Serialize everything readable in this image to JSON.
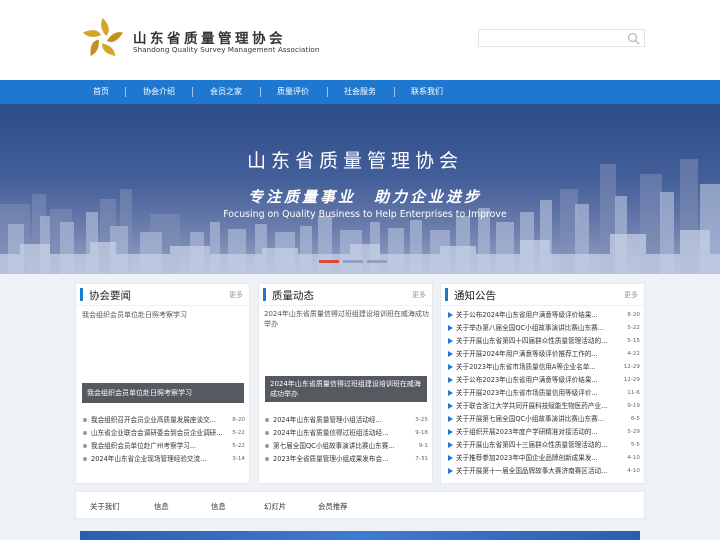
{
  "header": {
    "org_name_cn": "山东省质量管理协会",
    "org_name_en": "Shandong Quality Survey Management Association",
    "search_placeholder": ""
  },
  "nav": {
    "items": [
      "首页",
      "协会介绍",
      "会员之家",
      "质量评价",
      "社会服务",
      "联系我们"
    ]
  },
  "banner": {
    "title": "山东省质量管理协会",
    "slogan": "专注质量事业　助力企业进步",
    "slogan_en": "Focusing on Quality Business to Help Enterprises to Improve",
    "slides_total": 3,
    "active_slide": 1
  },
  "news": {
    "title": "协会要闻",
    "more": "更多",
    "photo_alt": "我会组织会员单位赴日照考察学习",
    "photo_caption": "我会组织会员单位赴日照考察学习",
    "items": [
      {
        "title": "我会组织召开会员企业高质量发展座谈交...",
        "date": "8-20"
      },
      {
        "title": "山东省企业联合会调研委会到会员企业调研...",
        "date": "5-22"
      },
      {
        "title": "我会组织会员单位赴广州考察学习...",
        "date": "5-22"
      },
      {
        "title": "2024年山东省企业现场管理经验交流...",
        "date": "3-14"
      }
    ]
  },
  "quality": {
    "title": "质量动态",
    "more": "更多",
    "photo_alt": "2024年山东省质量信得过班组建设培训班在威海成功举办",
    "photo_caption": "2024年山东省质量信得过班组建设培训班在威海成功举办",
    "items": [
      {
        "title": "2024年山东省质量管理小组活动经...",
        "date": "3-25"
      },
      {
        "title": "2024年山东省质量信得过班组活动经...",
        "date": "9-18"
      },
      {
        "title": "第七届全国QC小组故事演讲比赛山东赛...",
        "date": "9-1"
      },
      {
        "title": "2023年全省质量管理小组成果发布会...",
        "date": "7-31"
      }
    ]
  },
  "notices": {
    "title": "通知公告",
    "more": "更多",
    "items": [
      {
        "title": "关于公布2024年山东省用户满意等级评价结果...",
        "date": "8-20"
      },
      {
        "title": "关于举办第八届全国QC小组故事演讲比赛山东赛...",
        "date": "5-22"
      },
      {
        "title": "关于开展山东省第四十四届群众性质量管理活动的...",
        "date": "5-15"
      },
      {
        "title": "关于开展2024年用户满意等级评价推荐工作的...",
        "date": "4-22"
      },
      {
        "title": "关于2023年山东省市场质量信用A等企业名单...",
        "date": "12-29"
      },
      {
        "title": "关于公布2023年山东省用户满意等级评价结果...",
        "date": "12-29"
      },
      {
        "title": "关于开展2023年山东省市场质量信用等级评价...",
        "date": "11-6"
      },
      {
        "title": "关于联合浙江大学共同开展科技赋能生物医药产业...",
        "date": "9-19"
      },
      {
        "title": "关于开展第七届全国QC小组故事演讲比赛山东赛...",
        "date": "6-5"
      },
      {
        "title": "关于组织开展2023年度产学研精准对接活动的...",
        "date": "5-29"
      },
      {
        "title": "关于开展山东省第四十三届群众性质量管理活动的...",
        "date": "5-5"
      },
      {
        "title": "关于推荐参加2023年中国企业品牌创新成果发...",
        "date": "4-10"
      },
      {
        "title": "关于开展第十一届全国品牌故事大赛济南赛区活动...",
        "date": "4-10"
      }
    ]
  },
  "footer": {
    "links": [
      "关于我们",
      "信息",
      "信息",
      "幻灯片",
      "会员推荐"
    ]
  },
  "colors": {
    "accent": "#1f78d0",
    "active_dot": "#e0483a"
  },
  "icons": {
    "search": "search-icon",
    "logo": "star-logo-icon"
  }
}
